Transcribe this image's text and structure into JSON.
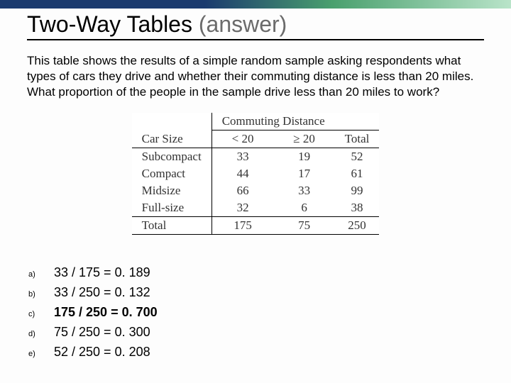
{
  "title_main": "Two-Way Tables ",
  "title_paren": "(answer)",
  "question": "This table shows the results of a simple random sample asking respondents what types of cars they drive and whether their commuting distance is less than 20 miles.  What proportion of the people in the sample drive less than 20 miles to work?",
  "table": {
    "row_header": "Car Size",
    "span_header": "Commuting Distance",
    "cols": [
      "< 20",
      "≥ 20",
      "Total"
    ],
    "rows": [
      {
        "label": "Subcompact",
        "vals": [
          "33",
          "19",
          "52"
        ]
      },
      {
        "label": "Compact",
        "vals": [
          "44",
          "17",
          "61"
        ]
      },
      {
        "label": "Midsize",
        "vals": [
          "66",
          "33",
          "99"
        ]
      },
      {
        "label": "Full-size",
        "vals": [
          "32",
          "6",
          "38"
        ]
      }
    ],
    "total_label": "Total",
    "totals": [
      "175",
      "75",
      "250"
    ]
  },
  "choices": [
    {
      "label": "a)",
      "text": "33 / 175 = 0. 189",
      "correct": false
    },
    {
      "label": "b)",
      "text": "33 / 250 = 0. 132",
      "correct": false
    },
    {
      "label": "c)",
      "text": "175 / 250 = 0. 700",
      "correct": true
    },
    {
      "label": "d)",
      "text": "75 / 250 = 0. 300",
      "correct": false
    },
    {
      "label": "e)",
      "text": "52 / 250 =  0. 208",
      "correct": false
    }
  ]
}
